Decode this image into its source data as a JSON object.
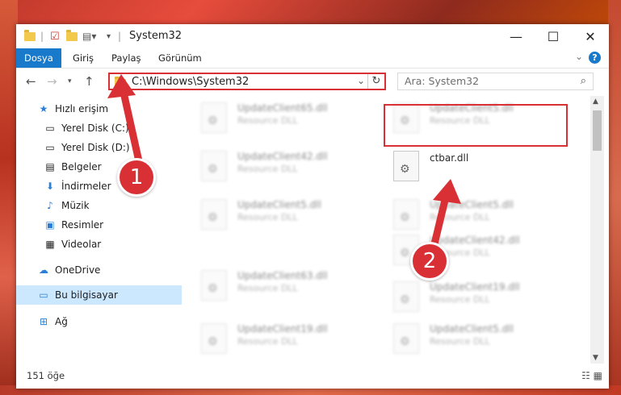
{
  "window": {
    "title": "System32",
    "controls": {
      "minimize": "—",
      "maximize": "☐",
      "close": "✕"
    }
  },
  "ribbon": {
    "tabs": [
      {
        "label": "Dosya",
        "active": true
      },
      {
        "label": "Giriş",
        "active": false
      },
      {
        "label": "Paylaş",
        "active": false
      },
      {
        "label": "Görünüm",
        "active": false
      }
    ],
    "help": "?"
  },
  "nav": {
    "address": "C:\\Windows\\System32",
    "search_placeholder": "Ara: System32"
  },
  "sidebar": {
    "items": [
      {
        "label": "Hızlı erişim",
        "icon": "star-icon",
        "pinned": false
      },
      {
        "label": "Yerel Disk (C:)",
        "icon": "drive-icon",
        "pinned": true
      },
      {
        "label": "Yerel Disk (D:)",
        "icon": "drive-icon",
        "pinned": true
      },
      {
        "label": "Belgeler",
        "icon": "documents-icon",
        "pinned": true
      },
      {
        "label": "İndirmeler",
        "icon": "download-icon",
        "pinned": true
      },
      {
        "label": "Müzik",
        "icon": "music-icon",
        "pinned": true
      },
      {
        "label": "Resimler",
        "icon": "pictures-icon",
        "pinned": true
      },
      {
        "label": "Videolar",
        "icon": "videos-icon",
        "pinned": true
      },
      {
        "label": "OneDrive",
        "icon": "cloud-icon",
        "pinned": false
      },
      {
        "label": "Bu bilgisayar",
        "icon": "computer-icon",
        "pinned": false,
        "selected": true
      },
      {
        "label": "Ağ",
        "icon": "network-icon",
        "pinned": false
      }
    ]
  },
  "files": [
    {
      "name": "UpdateClient65.dll",
      "type": "Resource DLL",
      "blurred": true
    },
    {
      "name": "UpdateClient5.dll",
      "type": "Resource DLL",
      "blurred": true
    },
    {
      "name": "UpdateClient42.dll",
      "type": "Resource DLL",
      "blurred": true
    },
    {
      "name": "ctbar.dll",
      "type": "",
      "blurred": false
    },
    {
      "name": "UpdateClient5.dll",
      "type": "Resource DLL",
      "blurred": true
    },
    {
      "name": "UpdateClient42.dll",
      "type": "Resource DLL",
      "blurred": true
    },
    {
      "name": "UpdateClient63.dll",
      "type": "Resource DLL",
      "blurred": true
    },
    {
      "name": "UpdateClient19.dll",
      "type": "Resource DLL",
      "blurred": true
    },
    {
      "name": "UpdateClient19.dll",
      "type": "Resource DLL",
      "blurred": true
    },
    {
      "name": "UpdateClient5.dll",
      "type": "Resource DLL",
      "blurred": true
    }
  ],
  "status": {
    "count": "151 öğe"
  },
  "annotations": {
    "step1": "1",
    "step2": "2",
    "color": "#d93035"
  }
}
